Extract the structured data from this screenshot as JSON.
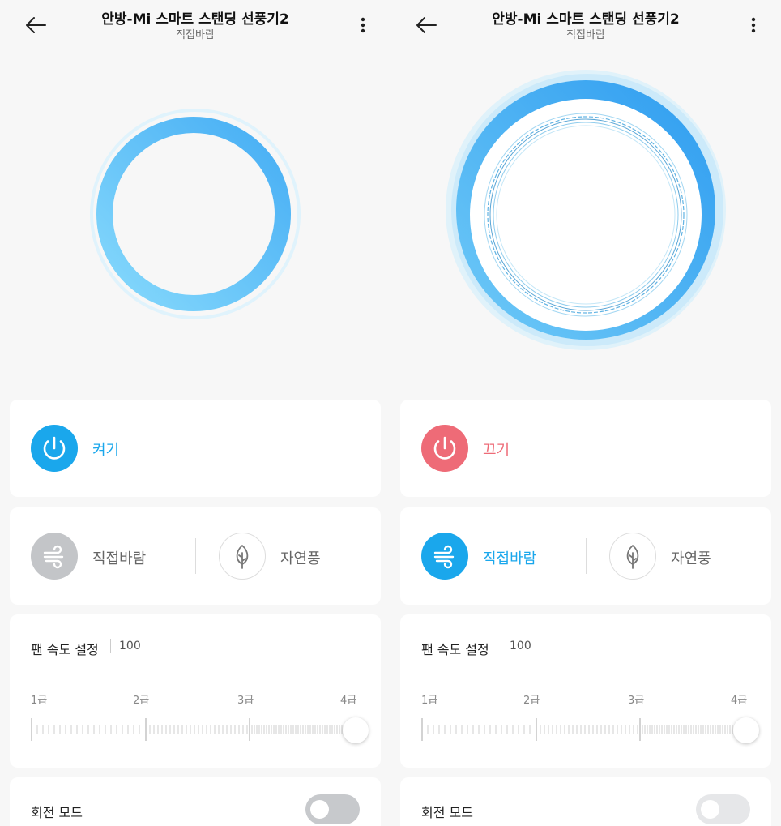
{
  "screens": [
    {
      "id": "left",
      "header": {
        "title": "안방-Mi 스마트 스탠딩 선풍기2",
        "subtitle": "직접바람"
      },
      "power": {
        "label": "켜기",
        "color": "#1aa7ec",
        "icon": "power-icon"
      },
      "modes": [
        {
          "label": "직접바람",
          "icon": "wind-icon",
          "active": false
        },
        {
          "label": "자연풍",
          "icon": "leaf-icon",
          "active": false
        }
      ],
      "speed": {
        "title": "팬 속도 설정",
        "value": "100",
        "levels": [
          "1급",
          "2급",
          "3급",
          "4급"
        ]
      },
      "rotate": {
        "label": "회전 모드",
        "on": false,
        "toggle_color": "#c7c9cc"
      },
      "fan_state": "off"
    },
    {
      "id": "right",
      "header": {
        "title": "안방-Mi 스마트 스탠딩 선풍기2",
        "subtitle": "직접바람"
      },
      "power": {
        "label": "끄기",
        "color": "#ee6b77",
        "icon": "power-icon"
      },
      "modes": [
        {
          "label": "직접바람",
          "icon": "wind-icon",
          "active": true
        },
        {
          "label": "자연풍",
          "icon": "leaf-icon",
          "active": false
        }
      ],
      "speed": {
        "title": "팬 속도 설정",
        "value": "100",
        "levels": [
          "1급",
          "2급",
          "3급",
          "4급"
        ]
      },
      "rotate": {
        "label": "회전 모드",
        "on": false,
        "toggle_color": "#e6e7e9"
      },
      "fan_state": "on"
    }
  ],
  "colors": {
    "accent_blue": "#1aa7ec",
    "off_red": "#ee6b77",
    "inactive_gray": "#c3c5c8",
    "ring_light": "#7fd3fb",
    "ring_dark": "#3fa9f5"
  }
}
